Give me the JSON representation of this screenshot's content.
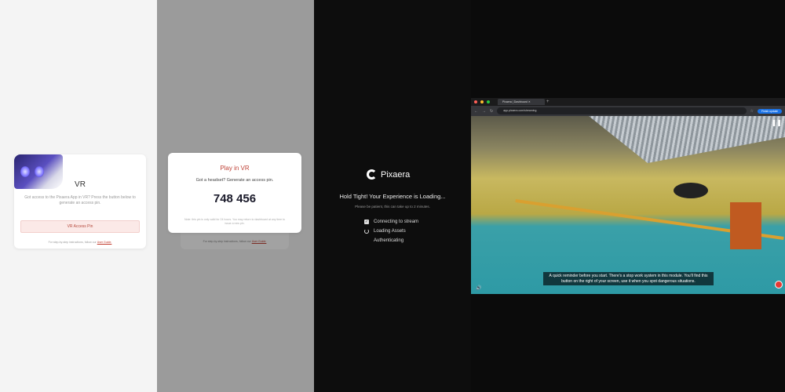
{
  "panel1": {
    "title": "VR",
    "description": "Got access to the Pixaera App in VR? Press the button below to generate an access pin.",
    "button": "VR Access Pin",
    "footer": "For step-by-step instructions, follow our ",
    "footer_link": "User Guide."
  },
  "panel2": {
    "title": "Play in VR",
    "subtitle": "Got a headset? Generate an access pin.",
    "pin": "748 456",
    "note": "Note: this pin is only valid for 24 hours. You may return to dashboard at any time to issue a new pin.",
    "footer": "For step-by-step instructions, follow our ",
    "footer_link": "User Guide."
  },
  "panel3": {
    "brand": "Pixaera",
    "heading": "Hold Tight! Your Experience is Loading...",
    "subheading": "Please be patient, this can take up to 2 minutes.",
    "steps": [
      {
        "label": "Connecting to stream",
        "status": "done"
      },
      {
        "label": "Loading Assets",
        "status": "loading"
      },
      {
        "label": "Authenticating",
        "status": "pending"
      }
    ]
  },
  "panel4": {
    "tab_title": "Pixaera | Dashboard",
    "url": "app.pixaera.com/streaming",
    "update_button": "Finish update",
    "caption": "A quick reminder before you start. There's a stop work system in this module. You'll find this button on the right of your screen, use it when you spot dangerous situations.",
    "colors": {
      "accent": "#1a73e8",
      "stop": "#e53935"
    }
  }
}
